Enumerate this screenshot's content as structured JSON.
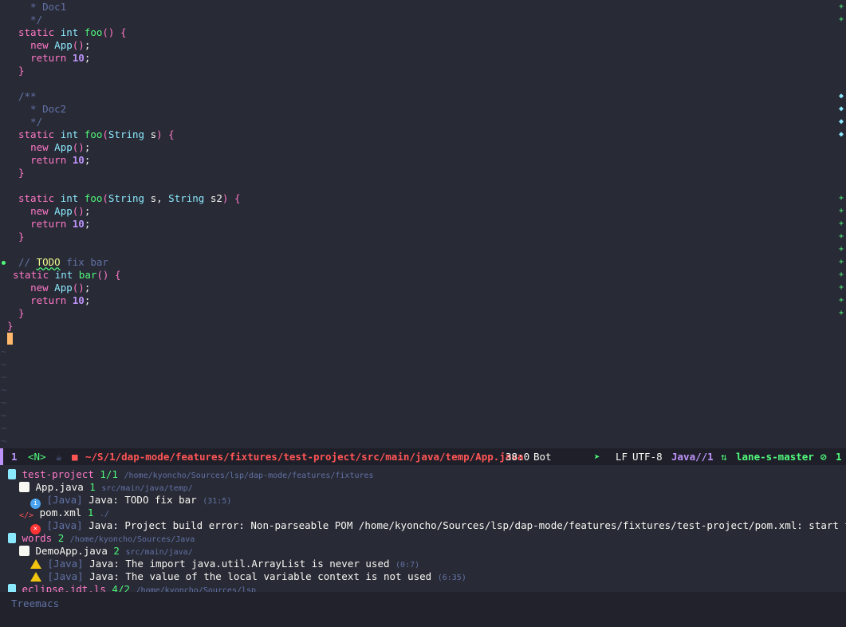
{
  "editor": {
    "lines": [
      [
        [
          "cm",
          "  * Doc1"
        ]
      ],
      [
        [
          "cm",
          "  */"
        ]
      ],
      [
        [
          "kw",
          "static "
        ],
        [
          "ty",
          "int "
        ],
        [
          "fn",
          "foo"
        ],
        [
          "br",
          "() {"
        ]
      ],
      [
        [
          "",
          "  "
        ],
        [
          "kw",
          "new "
        ],
        [
          "ty",
          "App"
        ],
        [
          "br",
          "()"
        ],
        [
          "",
          ";"
        ]
      ],
      [
        [
          "",
          "  "
        ],
        [
          "kw",
          "return "
        ],
        [
          "num",
          "10"
        ],
        [
          "",
          ";"
        ]
      ],
      [
        [
          "br",
          "}"
        ]
      ],
      [
        [
          "",
          ""
        ]
      ],
      [
        [
          "cm",
          "/**"
        ]
      ],
      [
        [
          "cm",
          "  * Doc2"
        ]
      ],
      [
        [
          "cm",
          "  */"
        ]
      ],
      [
        [
          "kw",
          "static "
        ],
        [
          "ty",
          "int "
        ],
        [
          "fn",
          "foo"
        ],
        [
          "br",
          "("
        ],
        [
          "ty",
          "String "
        ],
        [
          "",
          "s"
        ],
        [
          "br",
          ") {"
        ]
      ],
      [
        [
          "",
          "  "
        ],
        [
          "kw",
          "new "
        ],
        [
          "ty",
          "App"
        ],
        [
          "br",
          "()"
        ],
        [
          "",
          ";"
        ]
      ],
      [
        [
          "",
          "  "
        ],
        [
          "kw",
          "return "
        ],
        [
          "num",
          "10"
        ],
        [
          "",
          ";"
        ]
      ],
      [
        [
          "br",
          "}"
        ]
      ],
      [
        [
          "",
          ""
        ]
      ],
      [
        [
          "kw",
          "static "
        ],
        [
          "ty",
          "int "
        ],
        [
          "fn",
          "foo"
        ],
        [
          "br",
          "("
        ],
        [
          "ty",
          "String "
        ],
        [
          "",
          "s, "
        ],
        [
          "ty",
          "String "
        ],
        [
          "",
          "s2"
        ],
        [
          "br",
          ") {"
        ]
      ],
      [
        [
          "",
          "  "
        ],
        [
          "kw",
          "new "
        ],
        [
          "ty",
          "App"
        ],
        [
          "br",
          "()"
        ],
        [
          "",
          ";"
        ]
      ],
      [
        [
          "",
          "  "
        ],
        [
          "kw",
          "return "
        ],
        [
          "num",
          "10"
        ],
        [
          "",
          ";"
        ]
      ],
      [
        [
          "br",
          "}"
        ]
      ],
      [
        [
          "",
          ""
        ]
      ],
      [
        [
          "cm",
          "// "
        ],
        [
          "todo",
          "TODO"
        ],
        [
          "cm",
          " fix bar"
        ]
      ],
      [
        [
          "",
          "\b"
        ],
        [
          "kw",
          "static "
        ],
        [
          "ty",
          "int "
        ],
        [
          "fn",
          "bar"
        ],
        [
          "br",
          "() {"
        ]
      ],
      [
        [
          "",
          "  "
        ],
        [
          "kw",
          "new "
        ],
        [
          "ty",
          "App"
        ],
        [
          "br",
          "()"
        ],
        [
          "",
          ";"
        ]
      ],
      [
        [
          "",
          "  "
        ],
        [
          "kw",
          "return "
        ],
        [
          "num",
          "10"
        ],
        [
          "",
          ";"
        ]
      ],
      [
        [
          "br",
          "}"
        ]
      ],
      [
        [
          "br",
          "}"
        ]
      ]
    ],
    "tilde": "~"
  },
  "modeline": {
    "window_number": "1",
    "evil_state": "<N>",
    "path": "~/S/1/dap-mode/features/fixtures/test-project/src/main/java/temp/App.java",
    "position": "38:0",
    "scroll": "Bot",
    "eol": "LF",
    "encoding": "UTF-8",
    "mode": "Java//1",
    "branch": "lane-s-master",
    "error_count": "1",
    "colors": {
      "path": "#ff5555",
      "mode": "#bd93f9",
      "branch": "#50fa7b",
      "evil": "#50fa7b"
    }
  },
  "treemacs": {
    "rows": [
      {
        "icon": "project-icon",
        "parts": [
          [
            "proj",
            "test-project "
          ],
          [
            "cnt",
            "1/1 "
          ],
          [
            "small",
            "/home/kyoncho/Sources/lsp/dap-mode/features/fixtures"
          ]
        ]
      },
      {
        "icon": "java-file-icon",
        "indent": 1,
        "parts": [
          [
            "",
            "App.java "
          ],
          [
            "cnt",
            "1 "
          ],
          [
            "small",
            "src/main/java/temp/"
          ]
        ]
      },
      {
        "icon": "info-icon",
        "indent": 2,
        "parts": [
          [
            "dim",
            "[Java] "
          ],
          [
            "",
            "Java: TODO fix bar "
          ],
          [
            "small",
            "(31:5)"
          ]
        ]
      },
      {
        "icon": "xml-file-icon",
        "indent": 1,
        "parts": [
          [
            "",
            "pom.xml "
          ],
          [
            "cnt",
            "1 "
          ],
          [
            "small",
            "./"
          ]
        ]
      },
      {
        "icon": "error-icon",
        "indent": 2,
        "parts": [
          [
            "dim",
            "[Java] "
          ],
          [
            "",
            "Java: Project build error: Non-parseable POM /home/kyoncho/Sources/lsp/dap-mode/features/fixtures/test-project/pom.xml: start tag unexp"
          ]
        ]
      },
      {
        "icon": "project-icon",
        "parts": [
          [
            "proj",
            "words "
          ],
          [
            "cnt",
            "2 "
          ],
          [
            "small",
            "/home/kyoncho/Sources/Java"
          ]
        ]
      },
      {
        "icon": "java-file-icon",
        "indent": 1,
        "parts": [
          [
            "",
            "DemoApp.java "
          ],
          [
            "cnt",
            "2 "
          ],
          [
            "small",
            "src/main/java/"
          ]
        ]
      },
      {
        "icon": "warning-icon",
        "indent": 2,
        "parts": [
          [
            "dim",
            "[Java] "
          ],
          [
            "",
            "Java: The import java.util.ArrayList is never used "
          ],
          [
            "small",
            "(0:7)"
          ]
        ]
      },
      {
        "icon": "warning-icon",
        "indent": 2,
        "parts": [
          [
            "dim",
            "[Java] "
          ],
          [
            "",
            "Java: The value of the local variable context is not used "
          ],
          [
            "small",
            "(6:35)"
          ]
        ]
      },
      {
        "icon": "project-icon",
        "parts": [
          [
            "proj",
            "eclipse.jdt.ls "
          ],
          [
            "cnt",
            "4/2 "
          ],
          [
            "small",
            "/home/kyoncho/Sources/lsp"
          ]
        ]
      }
    ]
  },
  "echo_area": {
    "text": "Treemacs"
  }
}
